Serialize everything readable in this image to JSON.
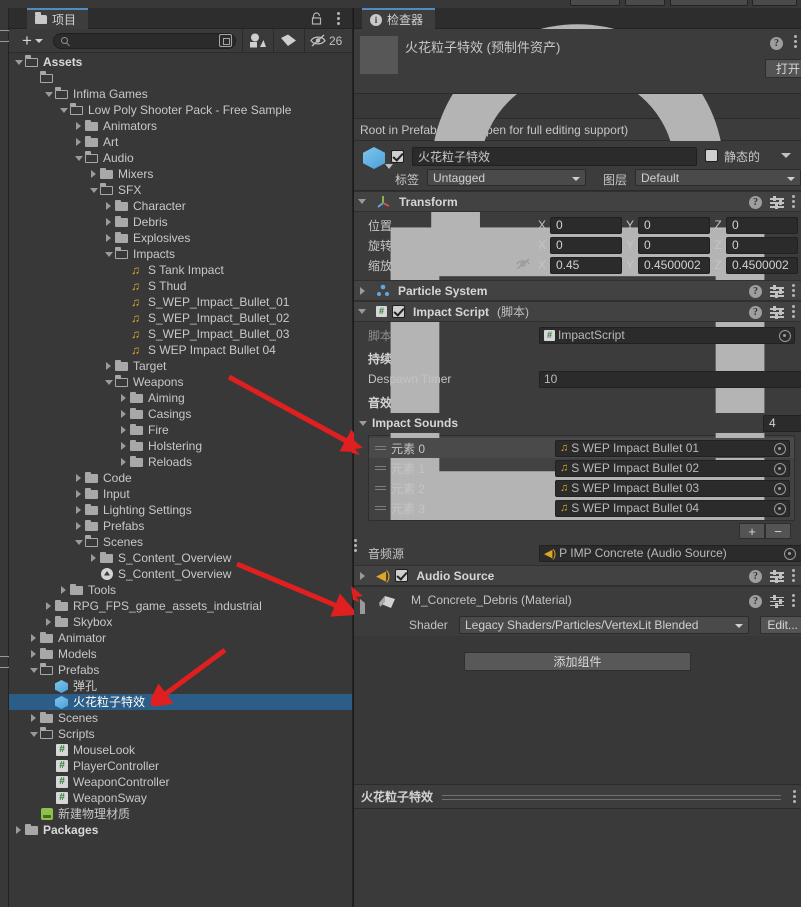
{
  "project_panel": {
    "tab_label": "项目",
    "tab_icon": "folder-icon",
    "toolbar": {
      "create_label": "+",
      "search_value": "",
      "search_placeholder": "",
      "hidden_count": "26"
    },
    "tree": [
      {
        "label": "Assets",
        "depth": 0,
        "arrow": "down",
        "icon": "folder-open-icon",
        "bold": true,
        "selected": false
      },
      {
        "label": "",
        "depth": 1,
        "arrow": "none",
        "icon": "folder-open-icon",
        "bold": false,
        "selected": false
      },
      {
        "label": "Infima Games",
        "depth": 2,
        "arrow": "down",
        "icon": "folder-open-icon",
        "bold": false,
        "selected": false
      },
      {
        "label": "Low Poly Shooter Pack - Free Sample",
        "depth": 3,
        "arrow": "down",
        "icon": "folder-open-icon",
        "bold": false,
        "selected": false
      },
      {
        "label": "Animators",
        "depth": 4,
        "arrow": "right",
        "icon": "folder-icon",
        "bold": false,
        "selected": false
      },
      {
        "label": "Art",
        "depth": 4,
        "arrow": "right",
        "icon": "folder-icon",
        "bold": false,
        "selected": false
      },
      {
        "label": "Audio",
        "depth": 4,
        "arrow": "down",
        "icon": "folder-open-icon",
        "bold": false,
        "selected": false
      },
      {
        "label": "Mixers",
        "depth": 5,
        "arrow": "right",
        "icon": "folder-icon",
        "bold": false,
        "selected": false
      },
      {
        "label": "SFX",
        "depth": 5,
        "arrow": "down",
        "icon": "folder-open-icon",
        "bold": false,
        "selected": false
      },
      {
        "label": "Character",
        "depth": 6,
        "arrow": "right",
        "icon": "folder-icon",
        "bold": false,
        "selected": false
      },
      {
        "label": "Debris",
        "depth": 6,
        "arrow": "right",
        "icon": "folder-icon",
        "bold": false,
        "selected": false
      },
      {
        "label": "Explosives",
        "depth": 6,
        "arrow": "right",
        "icon": "folder-icon",
        "bold": false,
        "selected": false
      },
      {
        "label": "Impacts",
        "depth": 6,
        "arrow": "down",
        "icon": "folder-open-icon",
        "bold": false,
        "selected": false
      },
      {
        "label": "S Tank Impact",
        "depth": 7,
        "arrow": "none",
        "icon": "audio-clip-icon",
        "bold": false,
        "selected": false
      },
      {
        "label": "S Thud",
        "depth": 7,
        "arrow": "none",
        "icon": "audio-clip-icon",
        "bold": false,
        "selected": false
      },
      {
        "label": "S_WEP_Impact_Bullet_01",
        "depth": 7,
        "arrow": "none",
        "icon": "audio-clip-icon",
        "bold": false,
        "selected": false
      },
      {
        "label": "S_WEP_Impact_Bullet_02",
        "depth": 7,
        "arrow": "none",
        "icon": "audio-clip-icon",
        "bold": false,
        "selected": false
      },
      {
        "label": "S_WEP_Impact_Bullet_03",
        "depth": 7,
        "arrow": "none",
        "icon": "audio-clip-icon",
        "bold": false,
        "selected": false
      },
      {
        "label": "S WEP Impact Bullet 04",
        "depth": 7,
        "arrow": "none",
        "icon": "audio-clip-icon",
        "bold": false,
        "selected": false
      },
      {
        "label": "Target",
        "depth": 6,
        "arrow": "right",
        "icon": "folder-icon",
        "bold": false,
        "selected": false
      },
      {
        "label": "Weapons",
        "depth": 6,
        "arrow": "down",
        "icon": "folder-open-icon",
        "bold": false,
        "selected": false
      },
      {
        "label": "Aiming",
        "depth": 7,
        "arrow": "right",
        "icon": "folder-icon",
        "bold": false,
        "selected": false
      },
      {
        "label": "Casings",
        "depth": 7,
        "arrow": "right",
        "icon": "folder-icon",
        "bold": false,
        "selected": false
      },
      {
        "label": "Fire",
        "depth": 7,
        "arrow": "right",
        "icon": "folder-icon",
        "bold": false,
        "selected": false
      },
      {
        "label": "Holstering",
        "depth": 7,
        "arrow": "right",
        "icon": "folder-icon",
        "bold": false,
        "selected": false
      },
      {
        "label": "Reloads",
        "depth": 7,
        "arrow": "right",
        "icon": "folder-icon",
        "bold": false,
        "selected": false
      },
      {
        "label": "Code",
        "depth": 4,
        "arrow": "right",
        "icon": "folder-icon",
        "bold": false,
        "selected": false
      },
      {
        "label": "Input",
        "depth": 4,
        "arrow": "right",
        "icon": "folder-icon",
        "bold": false,
        "selected": false
      },
      {
        "label": "Lighting Settings",
        "depth": 4,
        "arrow": "right",
        "icon": "folder-icon",
        "bold": false,
        "selected": false
      },
      {
        "label": "Prefabs",
        "depth": 4,
        "arrow": "right",
        "icon": "folder-icon",
        "bold": false,
        "selected": false
      },
      {
        "label": "Scenes",
        "depth": 4,
        "arrow": "down",
        "icon": "folder-open-icon",
        "bold": false,
        "selected": false
      },
      {
        "label": "S_Content_Overview",
        "depth": 5,
        "arrow": "right",
        "icon": "folder-icon",
        "bold": false,
        "selected": false
      },
      {
        "label": "S_Content_Overview",
        "depth": 5,
        "arrow": "none",
        "icon": "unity-scene-icon",
        "bold": false,
        "selected": false
      },
      {
        "label": "Tools",
        "depth": 3,
        "arrow": "right",
        "icon": "folder-icon",
        "bold": false,
        "selected": false
      },
      {
        "label": "RPG_FPS_game_assets_industrial",
        "depth": 2,
        "arrow": "right",
        "icon": "folder-icon",
        "bold": false,
        "selected": false
      },
      {
        "label": "Skybox",
        "depth": 2,
        "arrow": "right",
        "icon": "folder-icon",
        "bold": false,
        "selected": false
      },
      {
        "label": "Animator",
        "depth": 1,
        "arrow": "right",
        "icon": "folder-icon",
        "bold": false,
        "selected": false
      },
      {
        "label": "Models",
        "depth": 1,
        "arrow": "right",
        "icon": "folder-icon",
        "bold": false,
        "selected": false
      },
      {
        "label": "Prefabs",
        "depth": 1,
        "arrow": "down",
        "icon": "folder-open-icon",
        "bold": false,
        "selected": false
      },
      {
        "label": "弹孔",
        "depth": 2,
        "arrow": "none",
        "icon": "prefab-icon",
        "bold": false,
        "selected": false
      },
      {
        "label": "火花粒子特效",
        "depth": 2,
        "arrow": "none",
        "icon": "prefab-icon",
        "bold": false,
        "selected": true
      },
      {
        "label": "Scenes",
        "depth": 1,
        "arrow": "right",
        "icon": "folder-icon",
        "bold": false,
        "selected": false
      },
      {
        "label": "Scripts",
        "depth": 1,
        "arrow": "down",
        "icon": "folder-open-icon",
        "bold": false,
        "selected": false
      },
      {
        "label": "MouseLook",
        "depth": 2,
        "arrow": "none",
        "icon": "csharp-script-icon",
        "bold": false,
        "selected": false
      },
      {
        "label": "PlayerController",
        "depth": 2,
        "arrow": "none",
        "icon": "csharp-script-icon",
        "bold": false,
        "selected": false
      },
      {
        "label": "WeaponController",
        "depth": 2,
        "arrow": "none",
        "icon": "csharp-script-icon",
        "bold": false,
        "selected": false
      },
      {
        "label": "WeaponSway",
        "depth": 2,
        "arrow": "none",
        "icon": "csharp-script-icon",
        "bold": false,
        "selected": false
      },
      {
        "label": "新建物理材质",
        "depth": 1,
        "arrow": "none",
        "icon": "physic-material-icon",
        "bold": false,
        "selected": false
      },
      {
        "label": "Packages",
        "depth": 0,
        "arrow": "right",
        "icon": "folder-icon",
        "bold": true,
        "selected": false
      }
    ]
  },
  "inspector": {
    "tab_label": "检查器",
    "asset": {
      "title": "火花粒子特效 (预制件资产)",
      "open_button": "打开"
    },
    "prefab_note": "Root in Prefab Asset (Open for full editing support)",
    "gameobject": {
      "enabled": true,
      "name": "火花粒子特效",
      "static_label": "静态的",
      "static_checked": false,
      "tag_label": "标签",
      "tag_value": "Untagged",
      "layer_label": "图层",
      "layer_value": "Default"
    },
    "transform": {
      "title": "Transform",
      "position_label": "位置",
      "position": {
        "x": "0",
        "y": "0",
        "z": "0"
      },
      "rotation_label": "旋转",
      "rotation": {
        "x": "0",
        "y": "0",
        "z": "0"
      },
      "scale_label": "缩放",
      "scale": {
        "x": "0.45",
        "y": "0.4500002",
        "z": "0.4500002"
      }
    },
    "particle_system": {
      "title": "Particle System",
      "expanded": false
    },
    "impact_script": {
      "title": "Impact Script",
      "suffix": "(脚本)",
      "enabled": true,
      "script_label": "脚本",
      "script_value": "ImpactScript",
      "duration_section": "持续时间",
      "despawn_label": "Despawn Timer",
      "despawn_value": "10",
      "audio_section": "音效",
      "impact_sounds": {
        "title": "Impact Sounds",
        "size": "4",
        "items": [
          {
            "element_label": "元素 0",
            "value": "S WEP Impact Bullet 01"
          },
          {
            "element_label": "元素 1",
            "value": "S WEP Impact Bullet 02"
          },
          {
            "element_label": "元素 2",
            "value": "S WEP Impact Bullet 03"
          },
          {
            "element_label": "元素 3",
            "value": "S WEP Impact Bullet 04"
          }
        ],
        "add_label": "+",
        "remove_label": "−"
      },
      "audio_source_label": "音频源",
      "audio_source_value": "P IMP Concrete (Audio Source)"
    },
    "audio_source": {
      "title": "Audio Source",
      "enabled": true,
      "expanded": false
    },
    "material": {
      "name": "M_Concrete_Debris (Material)",
      "shader_label": "Shader",
      "shader_value": "Legacy Shaders/Particles/VertexLit Blended",
      "edit_label": "Edit..."
    },
    "add_component_label": "添加组件",
    "footer_title": "火花粒子特效"
  },
  "colors": {
    "panel_bg": "#383838",
    "header_bg": "#3c3c3c",
    "selection_blue": "#2c5d87",
    "tab_accent": "#4e8cc2",
    "annotation_red": "#e02020",
    "audio_yellow": "#e0a526",
    "prefab_blue": "#4ba0d6"
  }
}
